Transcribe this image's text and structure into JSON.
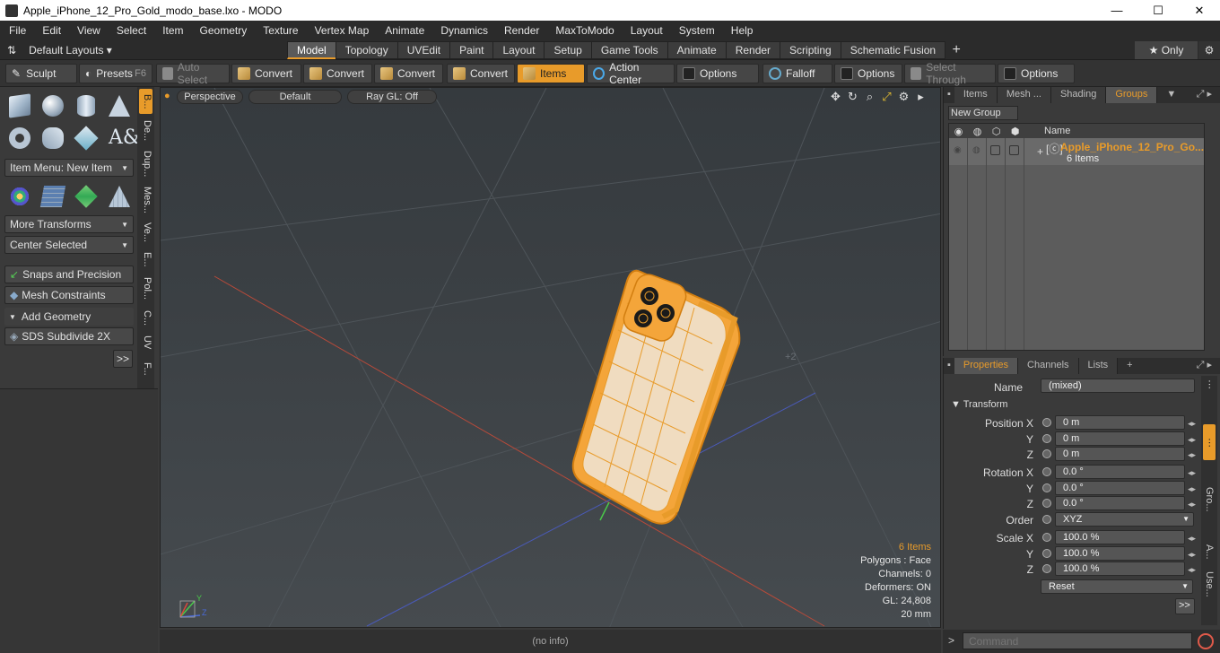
{
  "window": {
    "title": "Apple_iPhone_12_Pro_Gold_modo_base.lxo - MODO",
    "min": "—",
    "max": "☐",
    "close": "✕"
  },
  "menu": [
    "File",
    "Edit",
    "View",
    "Select",
    "Item",
    "Geometry",
    "Texture",
    "Vertex Map",
    "Animate",
    "Dynamics",
    "Render",
    "MaxToModo",
    "Layout",
    "System",
    "Help"
  ],
  "layouts": {
    "label": "Default Layouts ▾",
    "tabs": [
      "Model",
      "Topology",
      "UVEdit",
      "Paint",
      "Layout",
      "Setup",
      "Game Tools",
      "Animate",
      "Render",
      "Scripting",
      "Schematic Fusion"
    ],
    "active_tab": "Model",
    "plus": "+",
    "only": "★  Only"
  },
  "toolbar": {
    "sculpt": "Sculpt",
    "presets": "Presets",
    "presets_key": "F6",
    "auto_select": "Auto Select",
    "convert1": "Convert",
    "convert2": "Convert",
    "convert3": "Convert",
    "convert4": "Convert",
    "items": "Items",
    "action_center": "Action Center",
    "options1": "Options",
    "falloff": "Falloff",
    "options2": "Options",
    "select_through": "Select Through",
    "options3": "Options"
  },
  "left_panel": {
    "item_menu": "Item Menu: New Item",
    "more_transforms": "More Transforms",
    "center_selected": "Center Selected",
    "snaps": "Snaps and Precision",
    "mesh_constraints": "Mesh Constraints",
    "add_geometry": "Add Geometry",
    "sds_subdivide": "SDS Subdivide 2X",
    "more": ">>",
    "vtabs": [
      "B...",
      "De...",
      "Dup...",
      "Mes...",
      "Ve...",
      "E...",
      "Pol...",
      "C...",
      "UV",
      "F..."
    ]
  },
  "viewport": {
    "perspective": "Perspective",
    "default": "Default",
    "raygl": "Ray GL: Off",
    "marker": "+2",
    "axis_y": "Y",
    "axis_z": "Z",
    "stats": {
      "items": "6 Items",
      "polygons": "Polygons : Face",
      "channels": "Channels: 0",
      "deformers": "Deformers: ON",
      "gl": "GL: 24,808",
      "scale": "20 mm"
    }
  },
  "status": "(no info)",
  "groups_panel": {
    "tabs": [
      "Items",
      "Mesh ...",
      "Shading",
      "Groups"
    ],
    "active_tab": "Groups",
    "new_group": "New Group",
    "col_name": "Name",
    "group_name": "Apple_iPhone_12_Pro_Go...",
    "group_count": "6 Items"
  },
  "properties": {
    "tabs": [
      "Properties",
      "Channels",
      "Lists"
    ],
    "active_tab": "Properties",
    "name_label": "Name",
    "name_value": "(mixed)",
    "transform": "Transform",
    "position_label": "Position X",
    "rotation_label": "Rotation X",
    "scale_label": "Scale X",
    "y": "Y",
    "z": "Z",
    "position": [
      "0 m",
      "0 m",
      "0 m"
    ],
    "rotation": [
      "0.0 °",
      "0.0 °",
      "0.0 °"
    ],
    "order_label": "Order",
    "order_value": "XYZ",
    "scale": [
      "100.0 %",
      "100.0 %",
      "100.0 %"
    ],
    "reset": "Reset",
    "more": ">>",
    "side_tabs": [
      "Gro...",
      "A...",
      "Use..."
    ]
  },
  "command": {
    "prompt": ">",
    "placeholder": "Command"
  },
  "colors": {
    "accent": "#e89b2a",
    "phone": "#f4a53a"
  }
}
